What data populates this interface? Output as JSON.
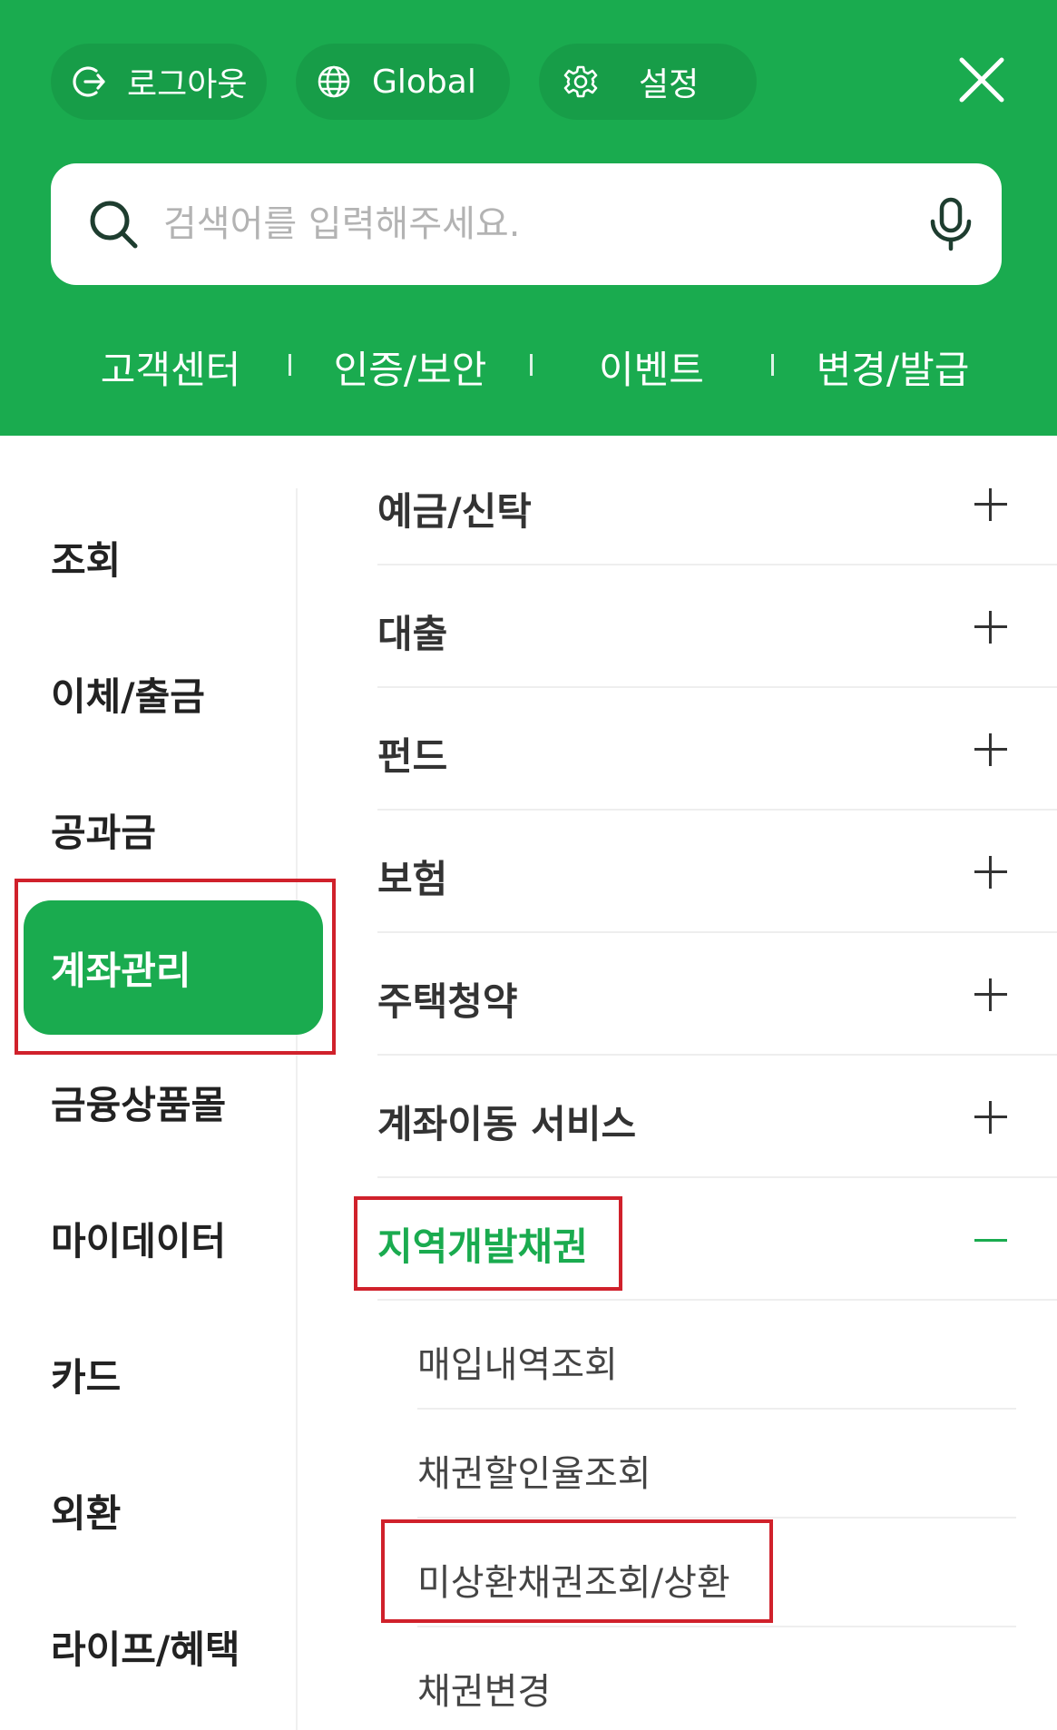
{
  "header": {
    "logout_label": "로그아웃",
    "global_label": "Global",
    "settings_label": "설정",
    "search_placeholder": "검색어를 입력해주세요.",
    "quick_links": [
      "고객센터",
      "인증/보안",
      "이벤트",
      "변경/발급"
    ]
  },
  "left_nav": {
    "items": [
      "조회",
      "이체/출금",
      "공과금",
      "계좌관리",
      "금융상품몰",
      "마이데이터",
      "카드",
      "외환",
      "라이프/혜택"
    ],
    "active": "계좌관리"
  },
  "menu": {
    "items": [
      "예금/신탁",
      "대출",
      "펀드",
      "보험",
      "주택청약",
      "계좌이동 서비스",
      "지역개발채권"
    ],
    "open_item": "지역개발채권",
    "sub_items": [
      "매입내역조회",
      "채권할인율조회",
      "미상환채권조회/상환",
      "채권변경"
    ]
  },
  "colors": {
    "brand_green": "#1aab4f",
    "highlight_red": "#d0212b"
  },
  "icons": {
    "logout": "logout-icon",
    "global": "globe-icon",
    "settings": "gear-icon",
    "close": "close-icon",
    "search": "search-icon",
    "mic": "microphone-icon",
    "expand": "plus-icon",
    "collapse": "minus-icon"
  }
}
